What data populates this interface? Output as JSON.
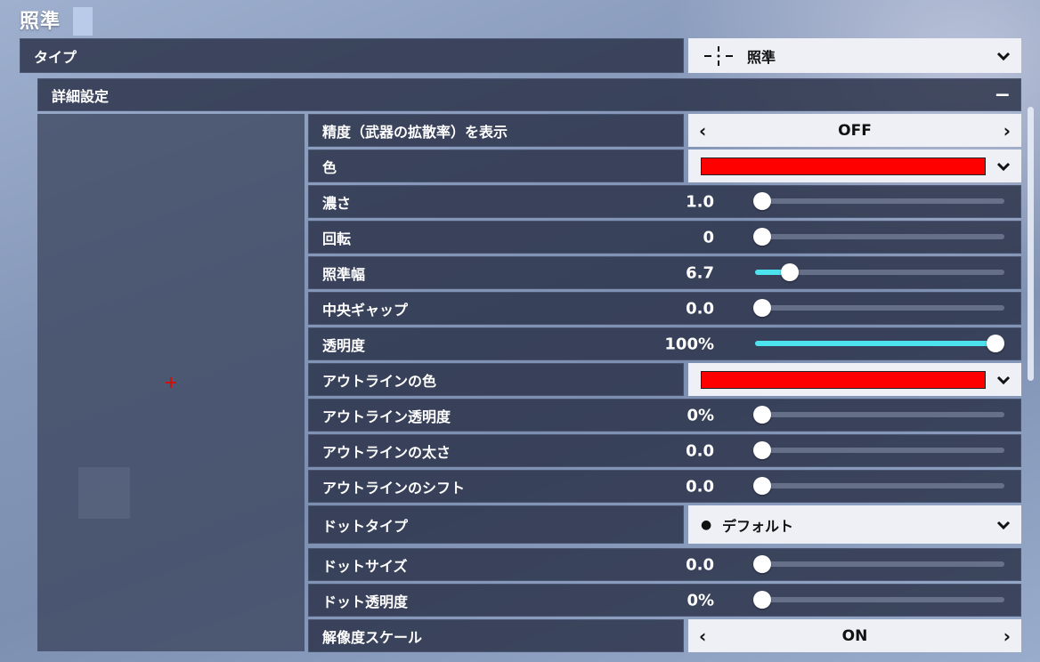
{
  "header": {
    "title": "照準"
  },
  "type_row": {
    "label": "タイプ",
    "selected": "照準",
    "icon": "crosshair-icon"
  },
  "section": {
    "title": "詳細設定",
    "collapse_symbol": "−"
  },
  "colors": {
    "accent": "#4de3ee",
    "crosshair_color": "#ff0000",
    "outline_color": "#ff0000"
  },
  "settings": {
    "accuracy": {
      "label": "精度（武器の拡散率）を表示",
      "value": "OFF"
    },
    "color": {
      "label": "色",
      "swatch": "#ff0000"
    },
    "opacity_strength": {
      "label": "濃さ",
      "value": "1.0",
      "level": 0.0
    },
    "rotation": {
      "label": "回転",
      "value": "0",
      "level": 0.0
    },
    "aim_width": {
      "label": "照準幅",
      "value": "6.7",
      "level": 0.14
    },
    "center_gap": {
      "label": "中央ギャップ",
      "value": "0.0",
      "level": 0.0
    },
    "transparency": {
      "label": "透明度",
      "value": "100%",
      "level": 1.0
    },
    "outline_color": {
      "label": "アウトラインの色",
      "swatch": "#ff0000"
    },
    "outline_opacity": {
      "label": "アウトライン透明度",
      "value": "0%",
      "level": 0.0
    },
    "outline_thickness": {
      "label": "アウトラインの太さ",
      "value": "0.0",
      "level": 0.0
    },
    "outline_shift": {
      "label": "アウトラインのシフト",
      "value": "0.0",
      "level": 0.0
    },
    "dot_type": {
      "label": "ドットタイプ",
      "selected": "デフォルト",
      "bullet": "●"
    },
    "dot_size": {
      "label": "ドットサイズ",
      "value": "0.0",
      "level": 0.0
    },
    "dot_opacity": {
      "label": "ドット透明度",
      "value": "0%",
      "level": 0.0
    },
    "resolution_scale": {
      "label": "解像度スケール",
      "value": "ON"
    }
  },
  "arrows": {
    "left": "‹",
    "right": "›"
  }
}
